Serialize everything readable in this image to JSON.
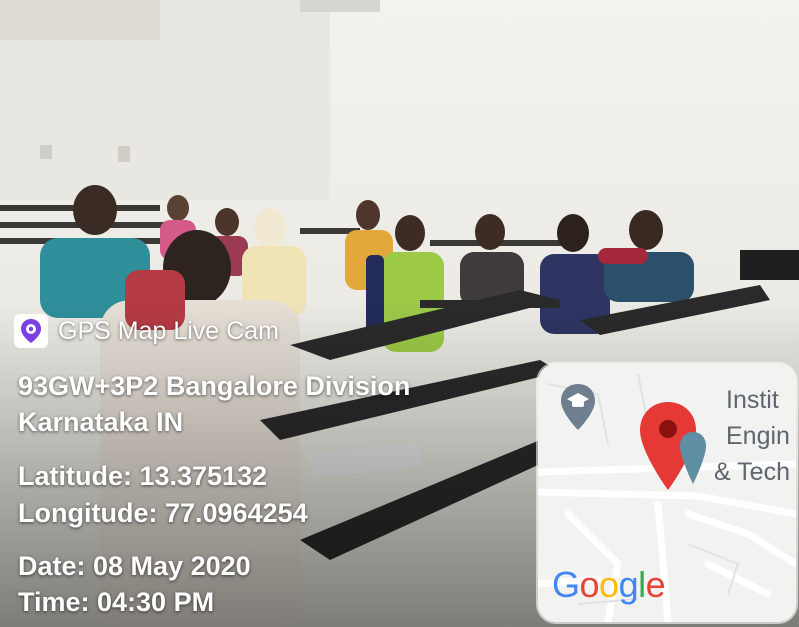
{
  "app": {
    "name": "GPS Map Live Cam",
    "icon": "gps-pin-icon"
  },
  "location": {
    "address_line1": "93GW+3P2 Bangalore Division",
    "address_line2": "Karnataka IN",
    "latitude_text": "Latitude: 13.375132",
    "longitude_text": "Longitude: 77.0964254",
    "date_text": "Date: 08 May 2020",
    "time_text": "Time: 04:30 PM"
  },
  "map": {
    "label_line1": "Instit",
    "label_line2": "Engin",
    "label_line3": "& Tech",
    "logo": {
      "letters": [
        "G",
        "o",
        "o",
        "g",
        "l",
        "e"
      ],
      "colors": [
        "#4285F4",
        "#EA4335",
        "#FBBC05",
        "#4285F4",
        "#34A853",
        "#EA4335"
      ]
    },
    "pin_color": "#E53935",
    "education_icon": "graduation-cap-icon"
  },
  "colors": {
    "overlay_text": "#ffffff"
  }
}
